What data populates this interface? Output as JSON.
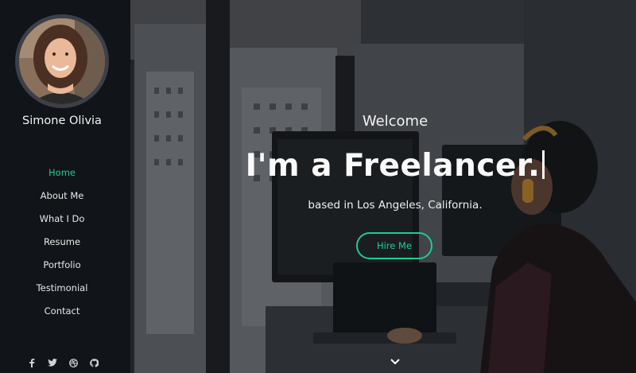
{
  "profile": {
    "name": "Simone Olivia"
  },
  "nav": {
    "items": [
      {
        "label": "Home",
        "active": true
      },
      {
        "label": "About Me",
        "active": false
      },
      {
        "label": "What I Do",
        "active": false
      },
      {
        "label": "Resume",
        "active": false
      },
      {
        "label": "Portfolio",
        "active": false
      },
      {
        "label": "Testimonial",
        "active": false
      },
      {
        "label": "Contact",
        "active": false
      }
    ]
  },
  "social": [
    "facebook-icon",
    "twitter-icon",
    "dribbble-icon",
    "github-icon"
  ],
  "hero": {
    "welcome": "Welcome",
    "headline": "I'm a Freelancer.",
    "location": "based in Los Angeles, California.",
    "cta_label": "Hire Me"
  },
  "colors": {
    "accent": "#20c997",
    "sidebar_bg": "#111418"
  }
}
